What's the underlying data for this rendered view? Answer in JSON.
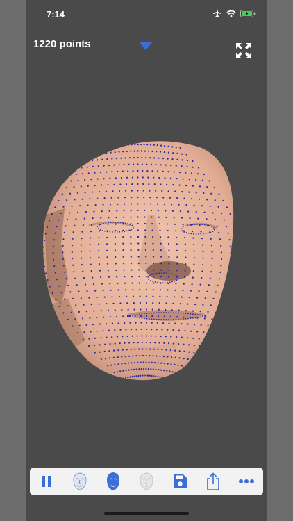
{
  "status_bar": {
    "time": "7:14",
    "icons": [
      "airplane-icon",
      "wifi-icon",
      "battery-charging-icon"
    ]
  },
  "header": {
    "points_label": "1220 points",
    "dropdown_icon": "triangle-down-icon",
    "expand_icon": "expand-arrows-icon"
  },
  "toolbar": {
    "items": [
      {
        "name": "pause-icon"
      },
      {
        "name": "face-wireframe-icon"
      },
      {
        "name": "face-mask-icon"
      },
      {
        "name": "face-shaded-icon"
      },
      {
        "name": "save-disk-icon"
      },
      {
        "name": "share-icon"
      },
      {
        "name": "more-icon"
      }
    ]
  },
  "colors": {
    "accent": "#3b6fd8",
    "face_skin": "#e9b49c",
    "face_shadow": "#b07f6a",
    "points": "#2a2aa0",
    "background": "#4a4a4a",
    "toolbar_bg": "#f2f2f2"
  }
}
